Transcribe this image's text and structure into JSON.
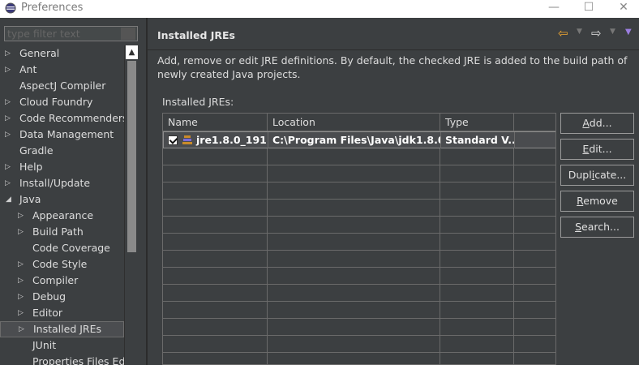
{
  "window": {
    "title": "Preferences",
    "min_glyph": "—",
    "max_glyph": "☐",
    "close_glyph": "✕"
  },
  "sidebar": {
    "filter_placeholder": "type filter text",
    "items": [
      {
        "label": "General",
        "expandable": true,
        "expanded": false,
        "indent": 0
      },
      {
        "label": "Ant",
        "expandable": true,
        "expanded": false,
        "indent": 0
      },
      {
        "label": "AspectJ Compiler",
        "expandable": false,
        "expanded": false,
        "indent": 0
      },
      {
        "label": "Cloud Foundry",
        "expandable": true,
        "expanded": false,
        "indent": 0
      },
      {
        "label": "Code Recommenders",
        "expandable": true,
        "expanded": false,
        "indent": 0
      },
      {
        "label": "Data Management",
        "expandable": true,
        "expanded": false,
        "indent": 0
      },
      {
        "label": "Gradle",
        "expandable": false,
        "expanded": false,
        "indent": 0
      },
      {
        "label": "Help",
        "expandable": true,
        "expanded": false,
        "indent": 0
      },
      {
        "label": "Install/Update",
        "expandable": true,
        "expanded": false,
        "indent": 0
      },
      {
        "label": "Java",
        "expandable": true,
        "expanded": true,
        "indent": 0
      },
      {
        "label": "Appearance",
        "expandable": true,
        "expanded": false,
        "indent": 1
      },
      {
        "label": "Build Path",
        "expandable": true,
        "expanded": false,
        "indent": 1
      },
      {
        "label": "Code Coverage",
        "expandable": false,
        "expanded": false,
        "indent": 1
      },
      {
        "label": "Code Style",
        "expandable": true,
        "expanded": false,
        "indent": 1
      },
      {
        "label": "Compiler",
        "expandable": true,
        "expanded": false,
        "indent": 1
      },
      {
        "label": "Debug",
        "expandable": true,
        "expanded": false,
        "indent": 1
      },
      {
        "label": "Editor",
        "expandable": true,
        "expanded": false,
        "indent": 1
      },
      {
        "label": "Installed JREs",
        "expandable": true,
        "expanded": false,
        "indent": 1,
        "selected": true
      },
      {
        "label": "JUnit",
        "expandable": false,
        "expanded": false,
        "indent": 1
      },
      {
        "label": "Properties Files Editor",
        "expandable": false,
        "expanded": false,
        "indent": 1
      }
    ]
  },
  "page": {
    "title": "Installed JREs",
    "description": "Add, remove or edit JRE definitions. By default, the checked JRE is added to the build path of newly created Java projects.",
    "list_label": "Installed JREs:",
    "columns": [
      "Name",
      "Location",
      "Type"
    ],
    "rows": [
      {
        "checked": true,
        "name": "jre1.8.0_191 ...",
        "location": "C:\\Program Files\\Java\\jdk1.8.0...",
        "type": "Standard V..."
      }
    ],
    "buttons": [
      {
        "pre": "",
        "mnemonic": "A",
        "post": "dd..."
      },
      {
        "pre": "",
        "mnemonic": "E",
        "post": "dit..."
      },
      {
        "pre": "Dupl",
        "mnemonic": "i",
        "post": "cate..."
      },
      {
        "pre": "",
        "mnemonic": "R",
        "post": "emove"
      },
      {
        "pre": "",
        "mnemonic": "S",
        "post": "earch..."
      }
    ]
  },
  "colors": {
    "background": "#3c3f41",
    "selection": "#4b4d50",
    "nav_back": "#f0a732",
    "menu_arrow": "#9b7ee0"
  }
}
